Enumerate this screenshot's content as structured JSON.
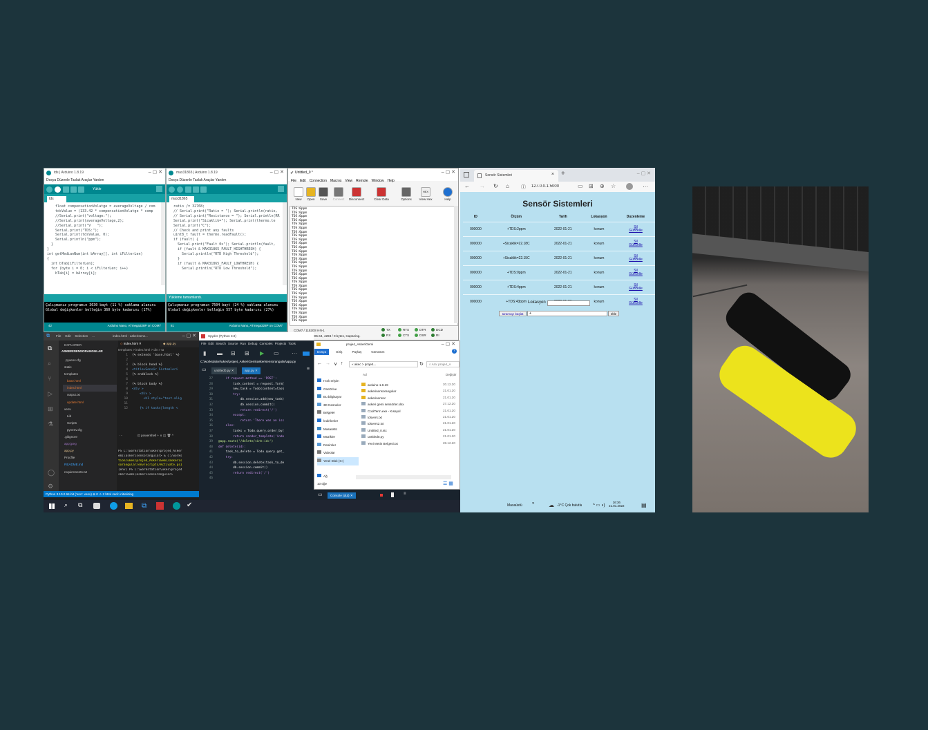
{
  "arduino1": {
    "title": "tds | Arduino 1.8.19",
    "menu": "Dosya  Düzenle  Taslak  Araçlar  Yardım",
    "upload_label": "Yükle",
    "tab": "tds",
    "code": [
      "    float compensationVolatge = averageVoltage / com",
      "    tdsValue = (133.42 * compensationVolatge * comp",
      "    //Serial.print(\"voltage:\");",
      "    //Serial.print(averageVoltage,2);",
      "    //Serial.print(\"V   \");",
      "    Serial.print(\"TDS:\");",
      "    Serial.print(tdsValue, 0);",
      "    Serial.println(\"ppm\");",
      "  }",
      "}",
      "int getMedianNum(int bArray[], int iFilterLen)",
      "{",
      "  int bTab[iFilterLen];",
      "  for (byte i = 0; i < iFilterLen; i++)",
      "    bTab[i] = bArray[i];"
    ],
    "console": [
      "Çalışmanız programın 3630 bayt (11 %) saklama alanını",
      "Global değişkenler belleğin 360 byte kadarını  (17%)"
    ],
    "footer_line": "42",
    "footer": "Arduino Nano, ATmega328P on COM7"
  },
  "arduino2": {
    "title": "max31865 | Arduino 1.8.19",
    "menu": "Dosya  Düzenle  Taslak  Araçlar  Yardım",
    "tab": "max31865",
    "code": [
      "  ratio /= 32768;",
      "  // Serial.print(\"Ratio = \"); Serial.println(ratio,",
      "  // Serial.print(\"Resistance = \"); Serial.println(RR",
      "  Serial.print(\"Sicaklik=\"); Serial.print(thermo.te",
      "  Serial.print(\"C\");",
      "",
      "  // Check and print any faults",
      "  uint8_t fault = thermo.readFault();",
      "  if (fault) {",
      "    Serial.print(\"Fault 0x\"); Serial.println(fault,",
      "    if (fault & MAX31865_FAULT_HIGHTHRESH) {",
      "      Serial.println(\"RTD High Threshold\");",
      "    }",
      "    if (fault & MAX31865_FAULT_LOWTHRESH) {",
      "      Serial.println(\"RTD Low Threshold\");"
    ],
    "status": "Yükleme tamamlandı.",
    "console": [
      "Çalışmanız programın 7504 bayt (24 %) saklama alanını",
      "Global değişkenler belleğin 557 byte kadarını  (27%)"
    ],
    "footer_line": "81",
    "footer": "Arduino Nano, ATmega328P on COM7"
  },
  "coolterm": {
    "title": "Untitled_0 *",
    "menu": [
      "File",
      "Edit",
      "Connection",
      "Macros",
      "View",
      "Remote",
      "Window",
      "Help"
    ],
    "buttons": [
      "New",
      "Open",
      "Save",
      "Connect",
      "Disconnect",
      "Clear Data",
      "Options",
      "View Hex",
      "Help"
    ],
    "hex_label": "HEX",
    "line": "TDS:0ppm",
    "status1": "COM7 / 115200 8-N-1",
    "status2": "Connected 00:05:44, 4293 / 0 bytes, Capturing.",
    "leds": [
      "TX",
      "RX",
      "RTS",
      "CTS",
      "DTR",
      "DSR",
      "DCD",
      "RI"
    ]
  },
  "browser": {
    "tab_title": "Sensör Sistemleri",
    "url": "127.0.0.1:5000",
    "heading": "Sensör Sistemleri",
    "columns": [
      "ID",
      "Ölçüm",
      "Tarih",
      "Lokasyon",
      "Duzenleme"
    ],
    "rows": [
      {
        "id": "000000",
        "olcum": "+TDS:2ppm",
        "tarih": "2022-01-21",
        "lokasyon": "konum"
      },
      {
        "id": "000000",
        "olcum": "+Sicaklik=22.18C",
        "tarih": "2022-01-21",
        "lokasyon": "konum"
      },
      {
        "id": "000000",
        "olcum": "+Sicaklik=22.15C",
        "tarih": "2022-01-21",
        "lokasyon": "konum"
      },
      {
        "id": "000000",
        "olcum": "+TDS:0ppm",
        "tarih": "2022-01-21",
        "lokasyon": "konum"
      },
      {
        "id": "000000",
        "olcum": "+TDS:4ppm",
        "tarih": "2022-01-21",
        "lokasyon": "konum"
      },
      {
        "id": "000000",
        "olcum": "+TDS:43ppm",
        "tarih": "2022-01-21",
        "lokasyon": "konum"
      }
    ],
    "sil": "Sil",
    "guncelle": "Güncelle",
    "lokasyon_label": "Lokasyon",
    "start_button": "taramayı başlat",
    "input_value": "+",
    "add_button": "ekle"
  },
  "vscode": {
    "title": "index.html - askerisens...",
    "menu": [
      "File",
      "Edit",
      "Selection",
      "..."
    ],
    "explorer_label": "EXPLORER",
    "project": "ASKERISENSORANGULAR",
    "tree": [
      "pyvenv.cfg",
      "static",
      "templates",
      "base.html",
      "index.html",
      "output.txt",
      "update.html",
      "venv",
      "Lib",
      "Scripts",
      "pyvenv.cfg",
      ".gitignore",
      "app.jpeg",
      "app.py",
      "Procfile",
      "README.md",
      "requirements.txt"
    ],
    "tabs": [
      "index.html",
      "app.py"
    ],
    "breadcrumb": "templates > index.html > div > ta",
    "code": [
      "{% extends 'base.html' %}",
      "",
      "{% block head %}",
      "<title>Sensör Sistemleri",
      "{% endblock %}",
      "",
      "{% block body %}",
      "<div >",
      "    <div >",
      "      <h1 style=\"text-alig",
      "",
      "    {% if tasks|length <"
    ],
    "terminal_label": "powershell",
    "terminal": [
      "PS C:\\workstation\\ukes\\proje4_Asker",
      "emi\\askerisensorangular> & c:/works",
      "tion/ukes/proje4_AskeriGemi/askeris",
      "sorangular/env/Scripts/Activate.ps1",
      "(env) PS C:\\workstation\\ukes\\proje4",
      "skeriGemi\\askerisensorangular> "
    ],
    "statusbar": "Python 3.10.0 64-bit ('env': venv)   ⊗ 0 ⚠ 2      html   Jedi: initializing"
  },
  "spyder": {
    "title": "Spyder (Python 3.9)",
    "menu": [
      "File",
      "Edit",
      "Search",
      "Source",
      "Run",
      "Debug",
      "Consoles",
      "Projects",
      "Tools"
    ],
    "path": "C:\\workstation\\ukes\\proje4_AskeriGemi\\askerisensorangular\\app.py",
    "tabs": [
      "untitled0.py",
      "app.py"
    ],
    "line_numbers": [
      "27",
      "28",
      "29",
      "30",
      "31",
      "32",
      "33",
      "34",
      "35",
      "36",
      "37",
      "38",
      "39",
      "40",
      "41",
      "42",
      "43",
      "44",
      "45",
      "46"
    ],
    "code": [
      "    if request.method == 'POST':",
      "        task_content = request.form[",
      "        new_task = Todo(content=task",
      "",
      "        try:",
      "            db.session.add(new_task)",
      "            db.session.commit()",
      "            return redirect('/')",
      "        except:",
      "            return 'There was an iss",
      "",
      "    else:",
      "        tasks = Todo.query.order_by(",
      "        return render_template('inde",
      "",
      "@app.route('/delete/<int:id>')",
      "def delete(id):",
      "    task_to_delete = Todo.query.get_",
      "",
      "    try:",
      "        db.session.delete(task_to_de",
      "        db.session.commit()",
      "        return redirect('/')"
    ]
  },
  "explorer": {
    "title": "proje4_AskeriGemi",
    "ribbon": [
      "Dosya",
      "Giriş",
      "Paylaş",
      "Görünüm"
    ],
    "path": "« akec > proje4...",
    "search": "Ara: proje4_A",
    "col_name": "Ad",
    "col_date": "Değiştir",
    "nav": [
      "Hızlı erişim",
      "OneDrive",
      "Bu bilgisayar",
      "3D Nesneler",
      "Belgeler",
      "İndirilenler",
      "Masaüstü",
      "Müzikler",
      "Resimler",
      "Videolar",
      "Yerel Disk (C:)",
      "Ağ"
    ],
    "files": [
      {
        "name": "arduino-1.8.19",
        "date": "20.12.20"
      },
      {
        "name": "askerisensorangular",
        "date": "21.01.20"
      },
      {
        "name": "askerisensor",
        "date": "21.01.20"
      },
      {
        "name": "askeri gemi sensörler.xlsx",
        "date": "27.12.20"
      },
      {
        "name": "CoolTerm.exe - Kısayol",
        "date": "21.01.20"
      },
      {
        "name": "tdsvers.txt",
        "date": "21.01.20"
      },
      {
        "name": "tdsvers2.txt",
        "date": "21.01.20"
      },
      {
        "name": "Untitled_0.stc",
        "date": "21.01.20"
      },
      {
        "name": "untitled0.py",
        "date": "21.01.20"
      },
      {
        "name": "Yeni Metin Belgesi.txt",
        "date": "28.12.20"
      }
    ],
    "count": "10 öğe",
    "console_tab": "Console (dut)"
  },
  "taskbar": {
    "desktop_label": "Masaüstü",
    "weather": "-1°C  Çok bulutlu",
    "time": "16:36",
    "date": "21.01.2022"
  },
  "colors": {
    "background": "#1c343c",
    "arduino": "#00878f",
    "arduino_light": "#17a1a5",
    "browser_bg": "#b8e0f0",
    "vscode_bg": "#1e1e1e",
    "vscode_status": "#007acc"
  }
}
